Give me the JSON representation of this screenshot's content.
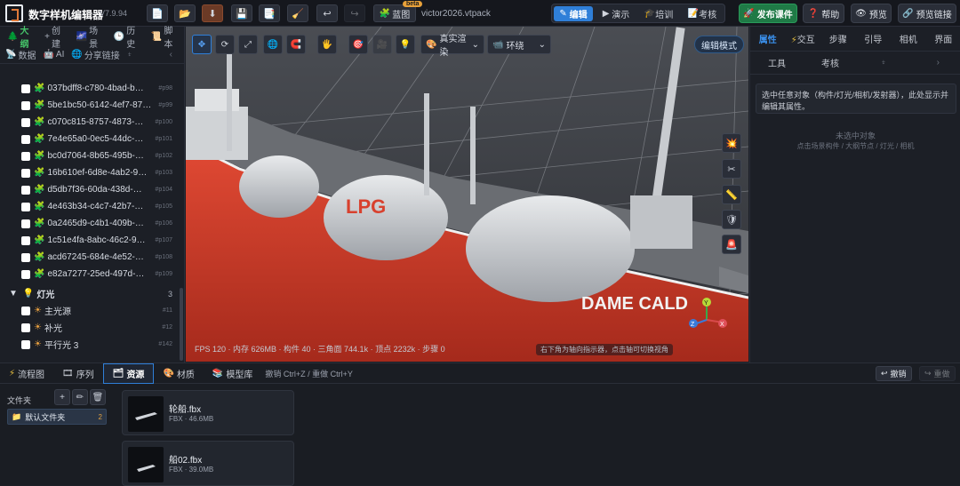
{
  "app": {
    "title": "数字样机编辑器",
    "version": "V7.9.94",
    "file_name": "victor2026.vtpack"
  },
  "toolbar": {
    "icons": [
      "new-file-icon",
      "open-folder-icon",
      "download-icon",
      "save-icon",
      "copy-icon",
      "clear-icon",
      "undo-icon",
      "redo-icon"
    ],
    "blueprint_label": "蓝图",
    "beta_badge": "beta"
  },
  "modes": [
    {
      "label": "编辑",
      "icon": "✎",
      "active": true
    },
    {
      "label": "演示",
      "icon": "▶",
      "active": false
    },
    {
      "label": "培训",
      "icon": "🎓",
      "active": false
    },
    {
      "label": "考核",
      "icon": "📝",
      "active": false
    }
  ],
  "top_actions": {
    "publish": "发布课件",
    "help": "帮助",
    "preview": "预览",
    "preview_link": "预览链接"
  },
  "left": {
    "tabs": [
      "大纲",
      "创建",
      "场景",
      "历史",
      "脚本"
    ],
    "tabs2": [
      "数据",
      "AI",
      "分享链接"
    ],
    "items": [
      {
        "label": "037bdff8-c780-4bad-b…",
        "id": "#p98"
      },
      {
        "label": "5be1bc50-6142-4ef7-87…",
        "id": "#p99"
      },
      {
        "label": "c070c815-8757-4873-…",
        "id": "#p100"
      },
      {
        "label": "7e4e65a0-0ec5-44dc-…",
        "id": "#p101"
      },
      {
        "label": "bc0d7064-8b65-495b-…",
        "id": "#p102"
      },
      {
        "label": "16b610ef-6d8e-4ab2-9…",
        "id": "#p103"
      },
      {
        "label": "d5db7f36-60da-438d-…",
        "id": "#p104"
      },
      {
        "label": "4e463b34-c4c7-42b7-…",
        "id": "#p105"
      },
      {
        "label": "0a2465d9-c4b1-409b-…",
        "id": "#p106"
      },
      {
        "label": "1c51e4fa-8abc-46c2-9…",
        "id": "#p107"
      },
      {
        "label": "acd67245-684e-4e52-…",
        "id": "#p108"
      },
      {
        "label": "e82a7277-25ed-497d-…",
        "id": "#p109"
      }
    ],
    "light_group": {
      "label": "灯光",
      "count": "3"
    },
    "lights": [
      {
        "label": "主光源",
        "id": "#11"
      },
      {
        "label": "补光",
        "id": "#12"
      },
      {
        "label": "平行光 3",
        "id": "#142"
      }
    ]
  },
  "viewport": {
    "render_mode": "真实渲染",
    "env_label": "环绕",
    "edit_mode": "编辑模式",
    "stats": "FPS 120 · 内存 626MB · 构件 40 · 三角面 744.1k · 顶点 2232k · 步骤 0",
    "axis_hint": "右下角为轴向指示器，点击轴可切换视角",
    "ship_text": "DAME CALD",
    "axes": {
      "y": "Y",
      "x": "X",
      "z": "Z"
    }
  },
  "right": {
    "tabs": [
      "属性",
      "交互",
      "步骤",
      "引导",
      "相机",
      "界面"
    ],
    "tabs2": [
      "工具",
      "考核"
    ],
    "hint": "选中任意对象（构件/灯光/相机/发射器），此处显示并编辑其属性。",
    "nosel_title": "未选中对象",
    "nosel_sub": "点击场景构件 / 大纲节点 / 灯光 / 相机"
  },
  "bottom": {
    "tabs": [
      "流程图",
      "序列",
      "资源",
      "材质",
      "模型库"
    ],
    "undo_hint": "撤销 Ctrl+Z / 重做 Ctrl+Y",
    "undo": "撤销",
    "redo": "重做",
    "folder_label": "文件夹",
    "folder": {
      "name": "默认文件夹",
      "count": "2"
    },
    "assets": [
      {
        "name": "轮船.fbx",
        "size": "FBX · 46.6MB"
      },
      {
        "name": "船02.fbx",
        "size": "FBX · 39.0MB"
      }
    ]
  },
  "colors": {
    "accent": "#2f7fd8",
    "publish": "#1f7a46",
    "hull": "#d8412e",
    "outline_active": "#46c46a"
  }
}
